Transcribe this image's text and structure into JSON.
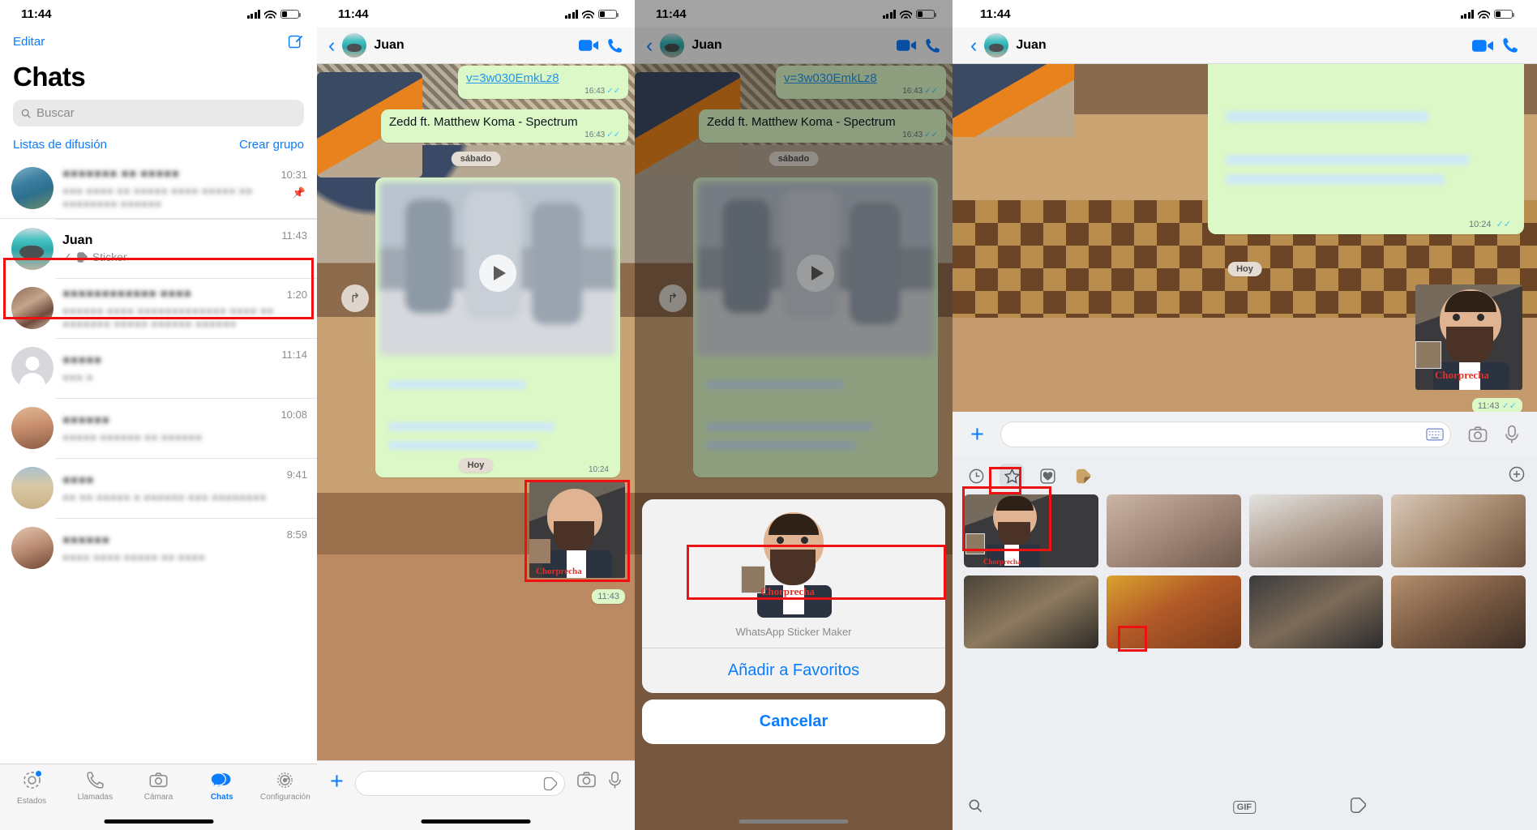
{
  "status_bar": {
    "time": "11:44"
  },
  "panel1": {
    "edit_label": "Editar",
    "compose_icon": "compose-icon",
    "title": "Chats",
    "search_placeholder": "Buscar",
    "broadcast_label": "Listas de difusión",
    "create_group_label": "Crear grupo",
    "chats": [
      {
        "name": "●●●●●●● ●● ●●●●●",
        "preview": "●●● ●●●● ●● ●●●●● ●●●● ●●●●● ●● ●●●●●●●● ●●●●●●",
        "time": "10:31",
        "blurred": true,
        "pinned": true
      },
      {
        "name": "Juan",
        "preview": "Sticker",
        "time": "11:43",
        "blurred": false,
        "pinned": false,
        "selected": true,
        "check": "✓",
        "sticker_icon": "sticker-icon"
      },
      {
        "name": "●●●●●●●●●●●● ●●●●",
        "preview": "●●●●●● ●●●● ●●●●●●●●●●●●● ●●●● ●● ●●●●●●● ●●●●● ●●●●●● ●●●●●●",
        "time": "1:20",
        "blurred": true
      },
      {
        "name": "●●●●●",
        "preview": "●●● ●",
        "time": "11:14",
        "blurred": true
      },
      {
        "name": "●●●●●●",
        "preview": "●●●●● ●●●●●● ●● ●●●●●●",
        "time": "10:08",
        "blurred": true
      },
      {
        "name": "●●●●",
        "preview": "●● ●● ●●●●● ● ●●●●●● ●●● ●●●●●●●●",
        "time": "9:41",
        "blurred": true
      },
      {
        "name": "●●●●●●",
        "preview": "●●●● ●●●● ●●●●● ●● ●●●●",
        "time": "8:59",
        "blurred": true
      }
    ],
    "tabs": [
      {
        "label": "Estados",
        "icon": "status-icon",
        "active": false,
        "badge": true
      },
      {
        "label": "Llamadas",
        "icon": "phone-icon",
        "active": false
      },
      {
        "label": "Cámara",
        "icon": "camera-icon",
        "active": false
      },
      {
        "label": "Chats",
        "icon": "chats-icon",
        "active": true
      },
      {
        "label": "Configuración",
        "icon": "gear-icon",
        "active": false
      }
    ]
  },
  "chat_header": {
    "back_icon": "back-chevron-icon",
    "contact_name": "Juan",
    "video_icon": "video-call-icon",
    "phone_icon": "voice-call-icon"
  },
  "panel2": {
    "messages": {
      "link_text": "v=3w030EmkLz8",
      "link_time": "16:43",
      "song_text": "Zedd ft. Matthew Koma - Spectrum",
      "song_time": "16:43",
      "day_separator_1": "sábado",
      "media_time": "10:24",
      "day_separator_2": "Hoy",
      "sticker_time": "11:43",
      "sticker_label": "Chorprecha"
    },
    "composer": {
      "plus_icon": "attach-plus-icon",
      "sticker_icon": "sticker-icon",
      "camera_icon": "camera-icon",
      "mic_icon": "microphone-icon"
    }
  },
  "panel3": {
    "action_sheet": {
      "title": "WhatsApp Sticker Maker",
      "sticker_label": "Chorprecha",
      "primary_action": "Añadir a Favoritos",
      "cancel_action": "Cancelar"
    }
  },
  "panel4": {
    "composer": {
      "plus_icon": "attach-plus-icon",
      "keyboard_icon": "keyboard-icon",
      "camera_icon": "camera-icon",
      "mic_icon": "microphone-icon"
    },
    "messages": {
      "media_time": "10:24",
      "day_separator": "Hoy",
      "sticker_time": "11:43",
      "sticker_label": "Chorprecha"
    },
    "picker_tabs": [
      {
        "icon": "recents-clock-icon",
        "selected": false
      },
      {
        "icon": "star-favorites-icon",
        "selected": true,
        "highlighted": true
      },
      {
        "icon": "heart-icon",
        "selected": false
      },
      {
        "icon": "sticker-pack-icon",
        "selected": false
      }
    ],
    "picker_add_icon": "add-circle-icon",
    "stickers": [
      {
        "label": "Chorprecha",
        "highlighted": true
      },
      {
        "label": ""
      },
      {
        "label": ""
      },
      {
        "label": ""
      },
      {
        "label": ""
      },
      {
        "label": ""
      },
      {
        "label": ""
      },
      {
        "label": ""
      }
    ],
    "picker_bottom": {
      "search_icon": "search-icon",
      "gif_label": "GIF",
      "sticker_icon": "sticker-icon",
      "sticker_highlighted": true
    }
  },
  "colors": {
    "accent": "#0a7cff",
    "highlight": "#ee1111",
    "bubble_out": "#dcf8c6",
    "link": "#2196f3"
  }
}
